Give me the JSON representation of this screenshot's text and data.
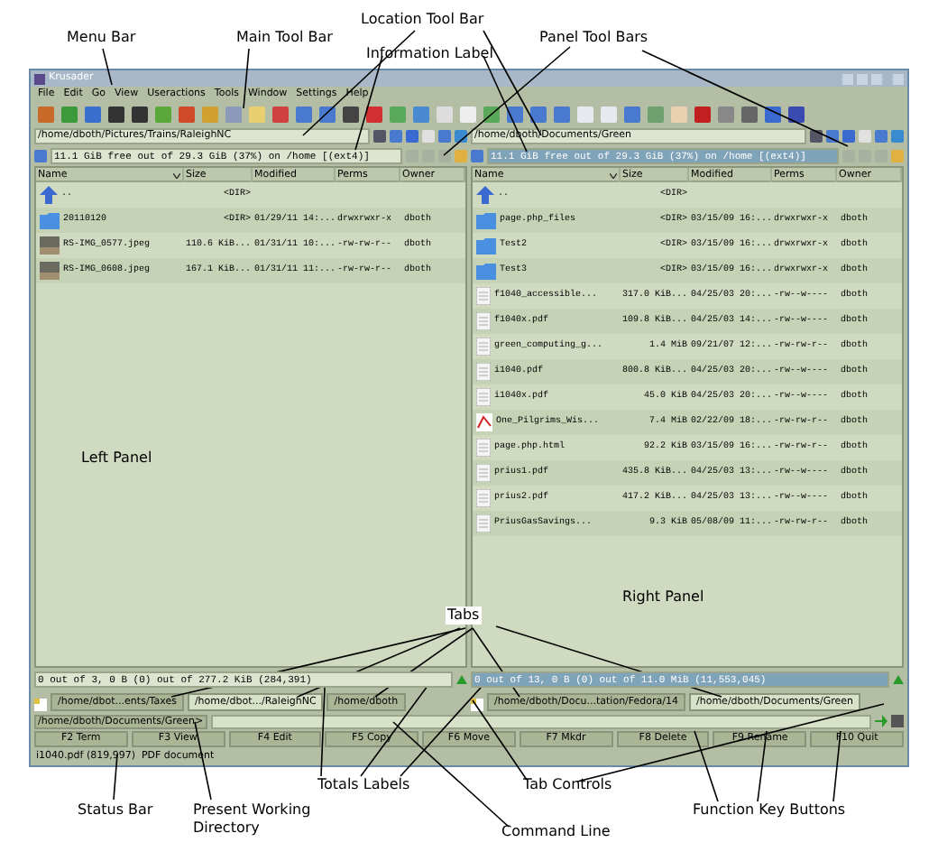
{
  "window": {
    "title": "Krusader"
  },
  "menu": [
    "File",
    "Edit",
    "Go",
    "View",
    "Useractions",
    "Tools",
    "Window",
    "Settings",
    "Help"
  ],
  "panels": [
    {
      "path": "/home/dboth/Pictures/Trains/RaleighNC",
      "info": "11.1 GiB free out of 29.3 GiB (37%) on /home [(ext4)]",
      "active": false,
      "columns": [
        "Name",
        "Size",
        "Modified",
        "Perms",
        "Owner"
      ],
      "rows": [
        {
          "kind": "up",
          "name": "..",
          "size": "<DIR>",
          "modified": "",
          "perms": "",
          "owner": ""
        },
        {
          "kind": "folder",
          "name": "20110120",
          "size": "<DIR>",
          "modified": "01/29/11 14:...",
          "perms": "drwxrwxr-x",
          "owner": "dboth"
        },
        {
          "kind": "image",
          "name": "RS-IMG_0577.jpeg",
          "size": "110.6 KiB...",
          "modified": "01/31/11 10:...",
          "perms": "-rw-rw-r--",
          "owner": "dboth"
        },
        {
          "kind": "image",
          "name": "RS-IMG_0608.jpeg",
          "size": "167.1 KiB...",
          "modified": "01/31/11 11:...",
          "perms": "-rw-rw-r--",
          "owner": "dboth"
        }
      ],
      "totals": "0 out of 3, 0 B (0) out of 277.2 KiB (284,391)",
      "tabs": [
        {
          "label": "/home/dbot...ents/Taxes",
          "selected": false
        },
        {
          "label": "/home/dbot.../RaleighNC",
          "selected": true
        },
        {
          "label": "/home/dboth",
          "selected": false
        }
      ]
    },
    {
      "path": "/home/dboth/Documents/Green",
      "info": "11.1 GiB free out of 29.3 GiB (37%) on /home [(ext4)]",
      "active": true,
      "columns": [
        "Name",
        "Size",
        "Modified",
        "Perms",
        "Owner"
      ],
      "rows": [
        {
          "kind": "up",
          "name": "..",
          "size": "<DIR>",
          "modified": "",
          "perms": "",
          "owner": ""
        },
        {
          "kind": "folder",
          "name": "page.php_files",
          "size": "<DIR>",
          "modified": "03/15/09 16:...",
          "perms": "drwxrwxr-x",
          "owner": "dboth"
        },
        {
          "kind": "folder",
          "name": "Test2",
          "size": "<DIR>",
          "modified": "03/15/09 16:...",
          "perms": "drwxrwxr-x",
          "owner": "dboth"
        },
        {
          "kind": "folder",
          "name": "Test3",
          "size": "<DIR>",
          "modified": "03/15/09 16:...",
          "perms": "drwxrwxr-x",
          "owner": "dboth"
        },
        {
          "kind": "document",
          "name": "f1040_accessible...",
          "size": "317.0 KiB...",
          "modified": "04/25/03 20:...",
          "perms": "-rw--w----",
          "owner": "dboth"
        },
        {
          "kind": "document",
          "name": "f1040x.pdf",
          "size": "109.8 KiB...",
          "modified": "04/25/03 14:...",
          "perms": "-rw--w----",
          "owner": "dboth"
        },
        {
          "kind": "document",
          "name": "green_computing_g...",
          "size": "1.4 MiB",
          "modified": "09/21/07 12:...",
          "perms": "-rw-rw-r--",
          "owner": "dboth"
        },
        {
          "kind": "document",
          "name": "i1040.pdf",
          "size": "800.8 KiB...",
          "modified": "04/25/03 20:...",
          "perms": "-rw--w----",
          "owner": "dboth"
        },
        {
          "kind": "document",
          "name": "i1040x.pdf",
          "size": "45.0 KiB",
          "modified": "04/25/03 20:...",
          "perms": "-rw--w----",
          "owner": "dboth"
        },
        {
          "kind": "pdf",
          "name": "One_Pilgrims_Wis...",
          "size": "7.4 MiB",
          "modified": "02/22/09 18:...",
          "perms": "-rw-rw-r--",
          "owner": "dboth"
        },
        {
          "kind": "document",
          "name": "page.php.html",
          "size": "92.2 KiB",
          "modified": "03/15/09 16:...",
          "perms": "-rw-rw-r--",
          "owner": "dboth"
        },
        {
          "kind": "document",
          "name": "prius1.pdf",
          "size": "435.8 KiB...",
          "modified": "04/25/03 13:...",
          "perms": "-rw--w----",
          "owner": "dboth"
        },
        {
          "kind": "document",
          "name": "prius2.pdf",
          "size": "417.2 KiB...",
          "modified": "04/25/03 13:...",
          "perms": "-rw--w----",
          "owner": "dboth"
        },
        {
          "kind": "document",
          "name": "PriusGasSavings...",
          "size": "9.3 KiB",
          "modified": "05/08/09 11:...",
          "perms": "-rw-rw-r--",
          "owner": "dboth"
        }
      ],
      "totals": "0 out of 13, 0 B (0) out of 11.0 MiB (11,553,045)",
      "tabs": [
        {
          "label": "/home/dboth/Docu...tation/Fedora/14",
          "selected": false
        },
        {
          "label": "/home/dboth/Documents/Green",
          "selected": true
        }
      ]
    }
  ],
  "command_line": {
    "directory": "/home/dboth/Documents/Green>"
  },
  "function_keys": [
    "F2 Term",
    "F3 View",
    "F4 Edit",
    "F5 Copy",
    "F6 Move",
    "F7 Mkdr",
    "F8 Delete",
    "F9 Rename",
    "F10 Quit"
  ],
  "status_bar": "i1040.pdf (819,997)  PDF document",
  "annotations": [
    "Location Tool Bar",
    "Menu Bar",
    "Main Tool Bar",
    "Panel Tool Bars",
    "Information Label",
    "Left Panel",
    "Right Panel",
    "Tabs",
    "Totals Labels",
    "Tab Controls",
    "Status Bar",
    "Present Working Directory",
    "Function Key Buttons",
    "Command Line"
  ]
}
